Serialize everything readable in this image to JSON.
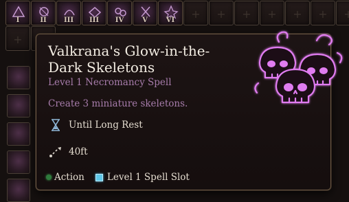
{
  "spell_bar": {
    "levels": [
      "I",
      "II",
      "III",
      "III",
      "IV",
      "V",
      "VI"
    ],
    "empty_slot_icon": "plus-icon"
  },
  "tooltip": {
    "title": "Valkrana's Glow-in-the-Dark Skeletons",
    "subtitle": "Level 1 Necromancy Spell",
    "description": "Create 3 miniature skeletons.",
    "duration": "Until Long Rest",
    "range": "40ft",
    "cost_action": "Action",
    "cost_slot": "Level 1 Spell Slot",
    "icons": {
      "duration": "hourglass-icon",
      "range": "range-arrow-icon",
      "spell_art": "glowing-skulls-icon"
    },
    "colors": {
      "accent": "#a77cab",
      "title": "#f2ece2",
      "action": "#2f7a3c",
      "spell_slot": "#5fc7e8",
      "skull_glow": "#e07cf0"
    }
  }
}
